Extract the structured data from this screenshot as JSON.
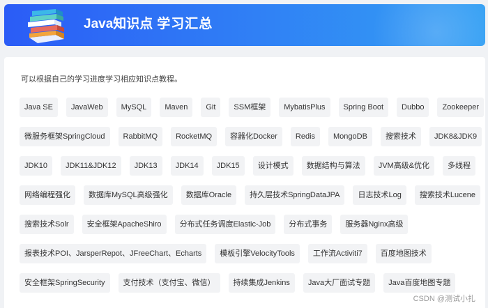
{
  "banner": {
    "title_bold": "Java知识点",
    "title_light": "学习汇总"
  },
  "intro": "可以根据自己的学习进度学习相应知识点教程。",
  "rows": [
    [
      "Java SE",
      "JavaWeb",
      "MySQL",
      "Maven",
      "Git",
      "SSM框架",
      "MybatisPlus",
      "Spring Boot",
      "Dubbo",
      "Zookeeper"
    ],
    [
      "微服务框架SpringCloud",
      "RabbitMQ",
      "RocketMQ",
      "容器化Docker",
      "Redis",
      "MongoDB",
      "搜索技术",
      "JDK8&JDK9"
    ],
    [
      "JDK10",
      "JDK11&JDK12",
      "JDK13",
      "JDK14",
      "JDK15",
      "设计模式",
      "数据结构与算法",
      "JVM高级&优化",
      "多线程"
    ],
    [
      "网络编程强化",
      "数据库MySQL高级强化",
      "数据库Oracle",
      "持久层技术SpringDataJPA",
      "日志技术Log",
      "搜索技术Lucene"
    ],
    [
      "搜索技术Solr",
      "安全框架ApacheShiro",
      "分布式任务调度Elastic-Job",
      "分布式事务",
      "服务器Nginx高级"
    ],
    [
      "报表技术POI、JarsperRepot、JFreeChart、Echarts",
      "模板引擎VelocityTools",
      "工作流Activiti7",
      "百度地图技术"
    ],
    [
      "安全框架SpringSecurity",
      "支付技术（支付宝、微信）",
      "持续集成Jenkins",
      "Java大厂面试专题",
      "Java百度地图专题"
    ]
  ],
  "watermark": "CSDN @测试小扎"
}
